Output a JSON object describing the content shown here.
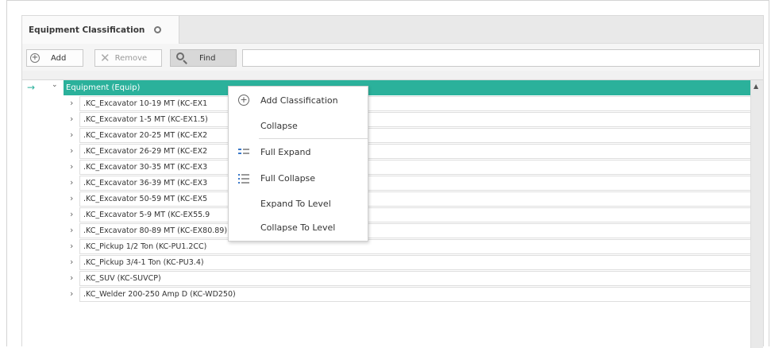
{
  "tab": {
    "title": "Equipment Classification"
  },
  "toolbar": {
    "add_label": "Add",
    "remove_label": "Remove",
    "find_label": "Find",
    "find_value": ""
  },
  "tree": {
    "root_label": "Equipment (Equip)",
    "rows": [
      ".KC_Excavator 10-19 MT (KC-EX1",
      ".KC_Excavator 1-5 MT (KC-EX1.5)",
      ".KC_Excavator 20-25 MT (KC-EX2",
      ".KC_Excavator 26-29 MT (KC-EX2",
      ".KC_Excavator 30-35 MT (KC-EX3",
      ".KC_Excavator 36-39 MT (KC-EX3",
      ".KC_Excavator 50-59 MT (KC-EX5",
      ".KC_Excavator 5-9 MT (KC-EX55.9",
      ".KC_Excavator 80-89 MT (KC-EX80.89)",
      ".KC_Pickup 1/2 Ton (KC-PU1.2CC)",
      ".KC_Pickup 3/4-1 Ton (KC-PU3.4)",
      ".KC_SUV (KC-SUVCP)",
      ".KC_Welder 200-250 Amp D (KC-WD250)"
    ]
  },
  "context_menu": {
    "items": [
      {
        "label": "Add Classification",
        "icon": "plus-circle-icon"
      },
      {
        "label": "Collapse",
        "icon": ""
      },
      {
        "label": "Full Expand",
        "icon": "full-expand-icon"
      },
      {
        "label": "Full Collapse",
        "icon": "full-collapse-icon"
      },
      {
        "label": "Expand To Level",
        "icon": ""
      },
      {
        "label": "Collapse To Level",
        "icon": ""
      }
    ]
  },
  "colors": {
    "accent": "#2bb19b",
    "icon_blue": "#3a78c8"
  }
}
